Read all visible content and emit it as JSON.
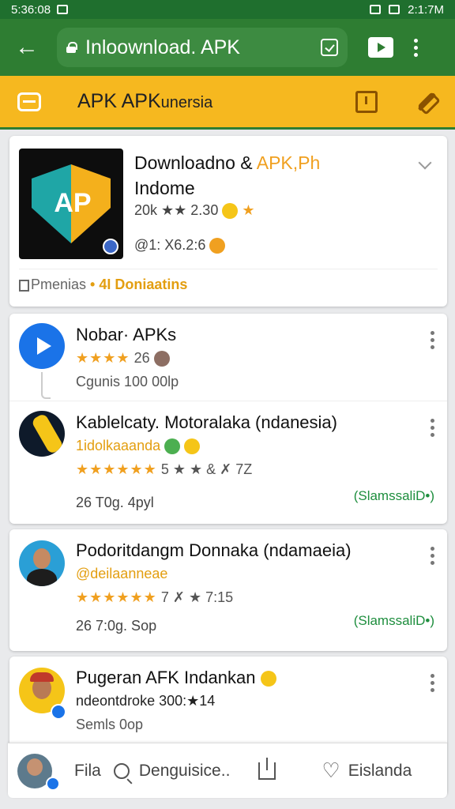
{
  "status_bar": {
    "time": "5:36:08",
    "right": "2:1:7M"
  },
  "url_bar": {
    "url": "Inloownload. APK"
  },
  "app_bar": {
    "title": "APK APK",
    "title_suffix": "unersia"
  },
  "featured": {
    "logo_letters": "AP",
    "title": "Downloadno &",
    "title_highlight": "APK,Ph",
    "title_line2": "Indome",
    "rating": "20k ★★ 2.30",
    "meta": "@1: X6.2:6",
    "tag1": "Pmenias",
    "tag2": "• 4I Doniaatins"
  },
  "items": [
    {
      "title": "Nobar· APKs",
      "stars": "★★★★",
      "rating": "26",
      "line3": "Cgunis 100 00lp"
    },
    {
      "title": "Kablelcaty. Motoralaka (ndanesia)",
      "subtitle": "1idolkaaanda",
      "stars": "★★★★★★",
      "stats": "5 ★ ★ & ✗ 7Z",
      "footer": "26 T0g. 4pyl",
      "status": "(SlamssaliD•)"
    },
    {
      "title": "Podoritdangm Donnaka (ndamaeia)",
      "subtitle": "@deilaanneae",
      "stars": "★★★★★★",
      "stats": "7 ✗ ★ 7:15",
      "footer": "26 7:0g. Sop",
      "status": "(SlamssaliD•)"
    },
    {
      "title": "Pugeran AFK Indankan",
      "subtitle": "ndeontdroke 300:★14",
      "line3": "Semls 0op"
    }
  ],
  "bottom_bar": {
    "label1": "Fila",
    "label2": "Denguisice..",
    "label3": "Eislanda"
  }
}
